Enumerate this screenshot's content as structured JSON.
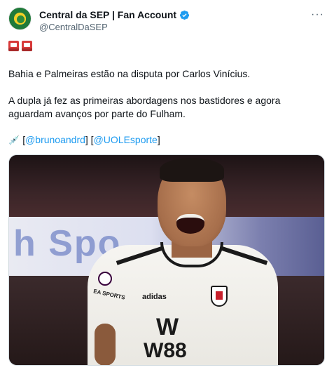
{
  "author": {
    "display_name": "Central da SEP | Fan Account",
    "handle": "@CentralDaSEP",
    "verified_icon": "verified-badge-icon",
    "brand_color": "#1d9bf0"
  },
  "menu": {
    "more_label": "···"
  },
  "tweet": {
    "flags_icon": "red-siren-emoji",
    "line1": "Bahia e Palmeiras estão na disputa por Carlos Vinícius.",
    "line2": "A dupla já fez as primeiras abordagens nos bastidores e agora aguardam avanços por parte do Fulham.",
    "source_icon": "syringe-emoji",
    "source_open": "[",
    "source_link1": "@brunoandrd",
    "source_mid": "] [",
    "source_link2": "@UOLEsporte",
    "source_close": "]"
  },
  "media": {
    "board_text": "h Spo",
    "kit_adidas": "adidas",
    "kit_sponsor_w": "W",
    "kit_sponsor_num": "W88",
    "sleeve_text": "EA SPORTS"
  }
}
